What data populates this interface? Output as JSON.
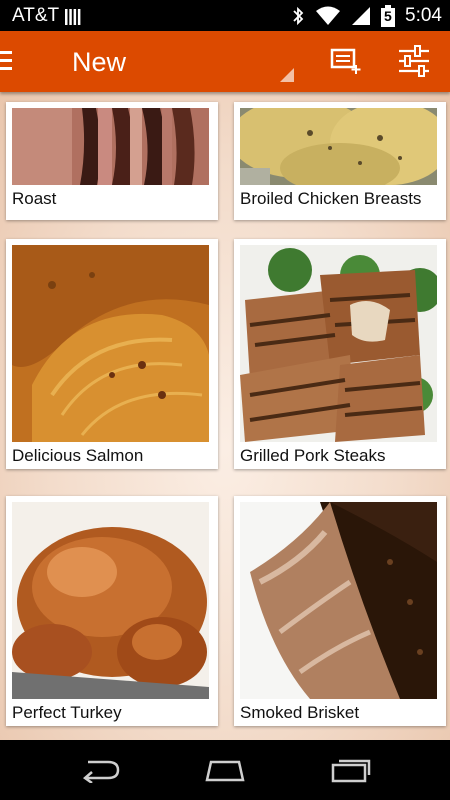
{
  "status_bar": {
    "carrier": "AT&T",
    "time": "5:04",
    "battery_level": "5",
    "icons": [
      "signal-bars-icon",
      "bluetooth-icon",
      "wifi-icon",
      "cell-signal-icon",
      "battery-icon"
    ]
  },
  "action_bar": {
    "title": "New",
    "icons": [
      "drawer-menu-icon",
      "add-recipe-icon",
      "filter-settings-icon"
    ],
    "colors": {
      "background": "#dc4a00"
    }
  },
  "recipes": [
    {
      "name": "Roast"
    },
    {
      "name": "Broiled Chicken Breasts"
    },
    {
      "name": "Delicious Salmon"
    },
    {
      "name": "Grilled Pork Steaks"
    },
    {
      "name": "Perfect Turkey"
    },
    {
      "name": "Smoked Brisket"
    }
  ],
  "nav_bar": {
    "icons": [
      "back-icon",
      "home-icon",
      "recent-apps-icon"
    ]
  }
}
